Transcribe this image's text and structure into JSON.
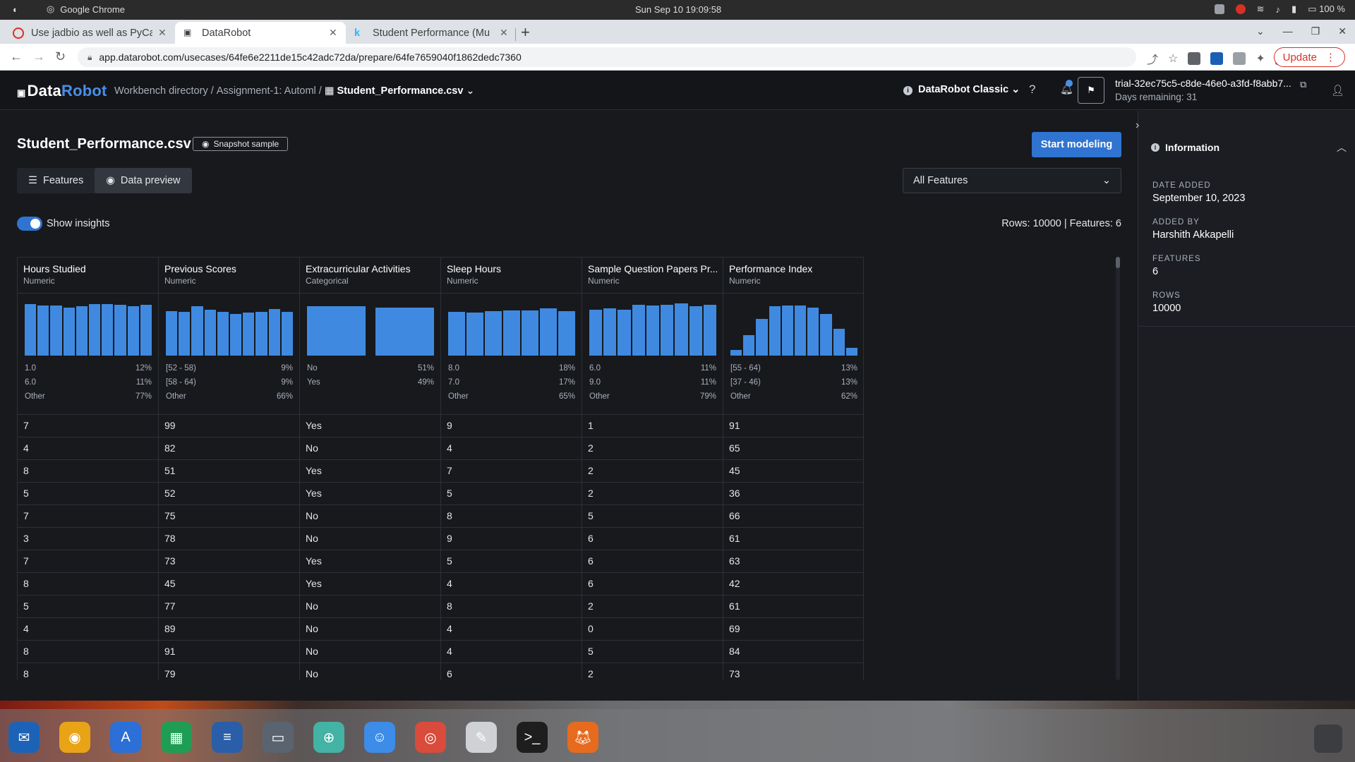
{
  "os": {
    "app_name": "Google Chrome",
    "clock": "Sun Sep 10  19:09:58",
    "battery": "100 %"
  },
  "browser": {
    "tabs": [
      {
        "title": "Use jadbio as well as PyCa"
      },
      {
        "title": "DataRobot"
      },
      {
        "title": "Student Performance (Mu"
      }
    ],
    "url": "app.datarobot.com/usecases/64fe6e2211de15c42adc72da/prepare/64fe7659040f1862dedc7360",
    "update_label": "Update"
  },
  "header": {
    "logo_data": "Data",
    "logo_robot": "Robot",
    "breadcrumb": {
      "item1": "Workbench directory",
      "sep1": "/",
      "item2": "Assignment-1: Automl",
      "sep2": "/",
      "current": "Student_Performance.csv"
    },
    "mode": "DataRobot Classic",
    "trial_id": "trial-32ec75c5-c8de-46e0-a3fd-f8abb7...",
    "days_remaining": "Days remaining: 31",
    "notification_count": "1"
  },
  "main": {
    "title": "Student_Performance.csv",
    "snapshot_label": "Snapshot sample",
    "start_modeling": "Start modeling",
    "view_tabs": {
      "features": "Features",
      "preview": "Data preview"
    },
    "feature_filter": "All Features",
    "show_insights": "Show insights",
    "counts": "Rows: 10000   |   Features: 6"
  },
  "table": {
    "columns": [
      {
        "name": "Hours Studied",
        "type": "Numeric",
        "hist_kind": "numeric",
        "hist": [
          0.96,
          0.93,
          0.93,
          0.9,
          0.92,
          0.96,
          0.96,
          0.95,
          0.92,
          0.95
        ],
        "stats": [
          [
            "1.0",
            "12%"
          ],
          [
            "6.0",
            "11%"
          ],
          [
            "Other",
            "77%"
          ]
        ]
      },
      {
        "name": "Previous Scores",
        "type": "Numeric",
        "hist_kind": "numeric",
        "hist": [
          0.83,
          0.81,
          0.92,
          0.86,
          0.82,
          0.78,
          0.8,
          0.81,
          0.87,
          0.81
        ],
        "stats": [
          [
            "[52 - 58)",
            "9%"
          ],
          [
            "[58 - 64)",
            "9%"
          ],
          [
            "Other",
            "66%"
          ]
        ]
      },
      {
        "name": "Extracurricular Activities",
        "type": "Categorical",
        "hist_kind": "categorical",
        "hist": [
          0.92,
          0.9
        ],
        "stats": [
          [
            "No",
            "51%"
          ],
          [
            "Yes",
            "49%"
          ]
        ]
      },
      {
        "name": "Sleep Hours",
        "type": "Numeric",
        "hist_kind": "numeric",
        "hist": [
          0.81,
          0.8,
          0.83,
          0.84,
          0.84,
          0.88,
          0.83
        ],
        "stats": [
          [
            "8.0",
            "18%"
          ],
          [
            "7.0",
            "17%"
          ],
          [
            "Other",
            "65%"
          ]
        ]
      },
      {
        "name": "Sample Question Papers Pr...",
        "type": "Numeric",
        "hist_kind": "numeric",
        "hist": [
          0.85,
          0.88,
          0.86,
          0.95,
          0.93,
          0.95,
          0.97,
          0.92,
          0.95
        ],
        "stats": [
          [
            "6.0",
            "11%"
          ],
          [
            "9.0",
            "11%"
          ],
          [
            "Other",
            "79%"
          ]
        ]
      },
      {
        "name": "Performance Index",
        "type": "Numeric",
        "hist_kind": "numeric",
        "hist": [
          0.1,
          0.38,
          0.68,
          0.92,
          0.94,
          0.94,
          0.9,
          0.78,
          0.5,
          0.14
        ],
        "stats": [
          [
            "[55 - 64)",
            "13%"
          ],
          [
            "[37 - 46)",
            "13%"
          ],
          [
            "Other",
            "62%"
          ]
        ]
      }
    ],
    "rows": [
      [
        "7",
        "99",
        "Yes",
        "9",
        "1",
        "91"
      ],
      [
        "4",
        "82",
        "No",
        "4",
        "2",
        "65"
      ],
      [
        "8",
        "51",
        "Yes",
        "7",
        "2",
        "45"
      ],
      [
        "5",
        "52",
        "Yes",
        "5",
        "2",
        "36"
      ],
      [
        "7",
        "75",
        "No",
        "8",
        "5",
        "66"
      ],
      [
        "3",
        "78",
        "No",
        "9",
        "6",
        "61"
      ],
      [
        "7",
        "73",
        "Yes",
        "5",
        "6",
        "63"
      ],
      [
        "8",
        "45",
        "Yes",
        "4",
        "6",
        "42"
      ],
      [
        "5",
        "77",
        "No",
        "8",
        "2",
        "61"
      ],
      [
        "4",
        "89",
        "No",
        "4",
        "0",
        "69"
      ],
      [
        "8",
        "91",
        "No",
        "4",
        "5",
        "84"
      ],
      [
        "8",
        "79",
        "No",
        "6",
        "2",
        "73"
      ]
    ]
  },
  "panel": {
    "title": "Information",
    "items": [
      {
        "label": "DATE ADDED",
        "value": "September 10, 2023"
      },
      {
        "label": "ADDED BY",
        "value": "Harshith Akkapelli"
      },
      {
        "label": "FEATURES",
        "value": "6"
      },
      {
        "label": "ROWS",
        "value": "10000"
      }
    ]
  },
  "dock": {
    "apps": [
      {
        "icon": "thunderbird-icon",
        "color": "#1c63b7"
      },
      {
        "icon": "rhythmbox-icon",
        "color": "#e8a317"
      },
      {
        "icon": "app-center-icon",
        "color": "#2c6fd6"
      },
      {
        "icon": "spreadsheet-icon",
        "color": "#1f9d55"
      },
      {
        "icon": "document-icon",
        "color": "#2a5ea8"
      },
      {
        "icon": "screenshot-icon",
        "color": "#5a6470"
      },
      {
        "icon": "help-icon",
        "color": "#42b3a4"
      },
      {
        "icon": "finder-icon",
        "color": "#3c8ce8"
      },
      {
        "icon": "chrome-icon",
        "color": "#d94b3b"
      },
      {
        "icon": "text-editor-icon",
        "color": "#cfd1d4"
      },
      {
        "icon": "terminal-icon",
        "color": "#1e1e1e"
      },
      {
        "icon": "firefox-icon",
        "color": "#e66b1f"
      }
    ]
  }
}
